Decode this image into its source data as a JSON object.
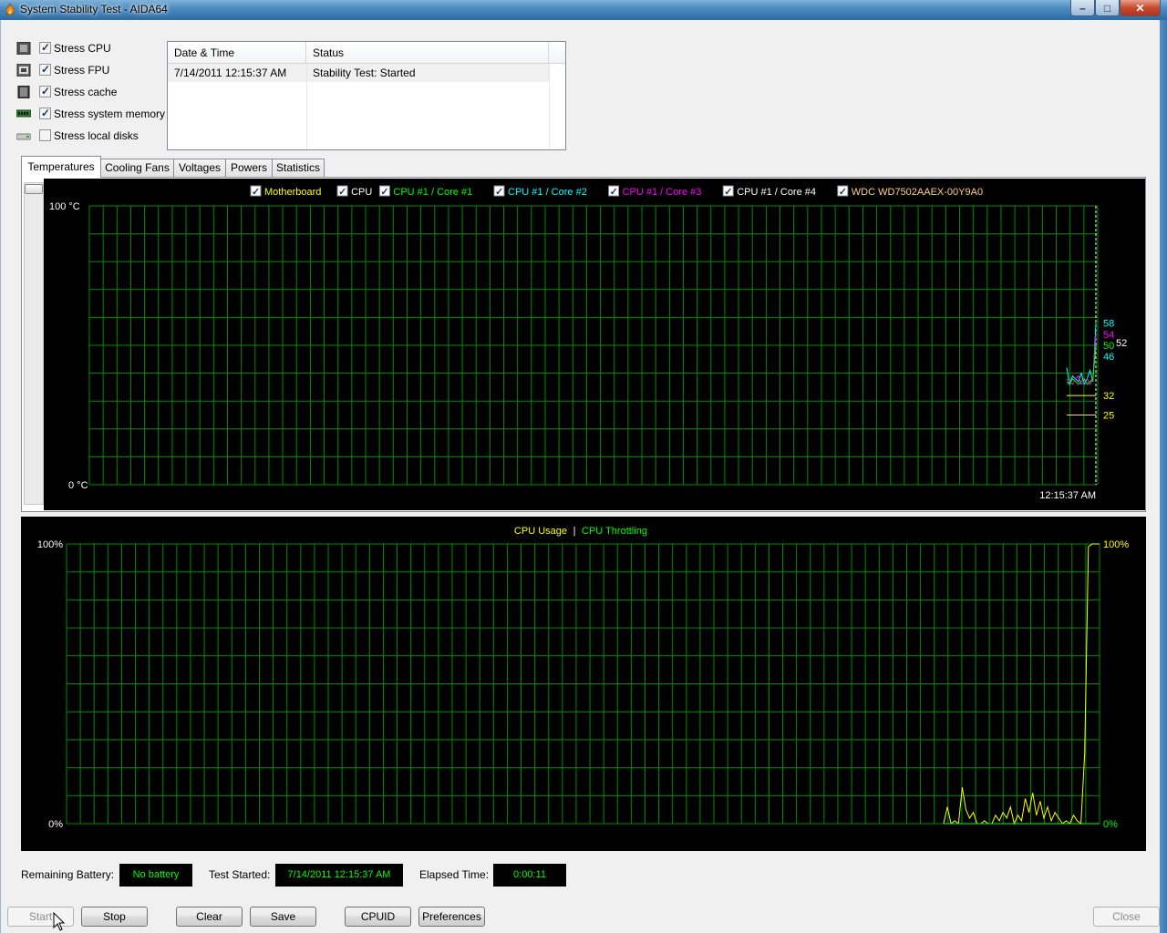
{
  "window": {
    "title": "System Stability Test - AIDA64",
    "min_glyph": "–",
    "max_glyph": "□",
    "close_glyph": "✕"
  },
  "stress_options": [
    {
      "label": "Stress CPU",
      "checked": true,
      "icon": "cpu-icon"
    },
    {
      "label": "Stress FPU",
      "checked": true,
      "icon": "fpu-icon"
    },
    {
      "label": "Stress cache",
      "checked": true,
      "icon": "cache-icon"
    },
    {
      "label": "Stress system memory",
      "checked": true,
      "icon": "memory-icon"
    },
    {
      "label": "Stress local disks",
      "checked": false,
      "icon": "disk-icon"
    }
  ],
  "log": {
    "headers": [
      "Date & Time",
      "Status"
    ],
    "rows": [
      {
        "datetime": "7/14/2011 12:15:37 AM",
        "status": "Stability Test: Started"
      }
    ]
  },
  "tabs": [
    "Temperatures",
    "Cooling Fans",
    "Voltages",
    "Powers",
    "Statistics"
  ],
  "active_tab": "Temperatures",
  "temperature_chart": {
    "y_max_label": "100 °C",
    "y_min_label": "0 °C",
    "time_label": "12:15:37 AM",
    "legend": [
      {
        "name": "Motherboard",
        "color": "#ffff00",
        "checked": true
      },
      {
        "name": "CPU",
        "color": "#ffffff",
        "checked": true
      },
      {
        "name": "CPU #1 / Core #1",
        "color": "#00ff00",
        "checked": true
      },
      {
        "name": "CPU #1 / Core #2",
        "color": "#00ffff",
        "checked": true
      },
      {
        "name": "CPU #1 / Core #3",
        "color": "#ff00ff",
        "checked": true
      },
      {
        "name": "CPU #1 / Core #4",
        "color": "#ffffff",
        "checked": true
      },
      {
        "name": "WDC WD7502AAEX-00Y9A0",
        "color": "#ffd27f",
        "checked": true
      }
    ],
    "value_labels": [
      {
        "text": "58",
        "value": 58,
        "color": "#00ffff"
      },
      {
        "text": "54",
        "value": 54,
        "color": "#ff00ff"
      },
      {
        "text": "52",
        "value": 51,
        "color": "#ffffff"
      },
      {
        "text": "50",
        "value": 50,
        "color": "#00ff00"
      },
      {
        "text": "46",
        "value": 46,
        "color": "#00ffff"
      },
      {
        "text": "32",
        "value": 32,
        "color": "#ffff00"
      },
      {
        "text": "25",
        "value": 25,
        "color": "#ffff00"
      }
    ]
  },
  "cpu_chart": {
    "legend_usage": "CPU Usage",
    "legend_separator": "|",
    "legend_throttling": "CPU Throttling",
    "usage_color": "#ffff00",
    "throttling_color": "#00ff00",
    "y_max_left": "100%",
    "y_min_left": "0%",
    "y_max_right": "100%",
    "y_min_right": "0%"
  },
  "chart_data": [
    {
      "type": "line",
      "title": "",
      "ylabel": "°C",
      "ylim": [
        0,
        100
      ],
      "series": [
        {
          "name": "CPU #1 / Core #2",
          "values": [
            42,
            36,
            39,
            38,
            37,
            40,
            36,
            38,
            41,
            37,
            58
          ]
        },
        {
          "name": "CPU #1 / Core #3",
          "values": [
            38,
            37,
            36,
            38,
            39,
            36,
            37,
            38,
            36,
            38,
            54
          ]
        },
        {
          "name": "CPU #1 / Core #1",
          "values": [
            37,
            36,
            38,
            37,
            36,
            37,
            38,
            36,
            37,
            38,
            50
          ]
        },
        {
          "name": "Motherboard",
          "values": [
            32,
            32,
            32,
            32,
            32,
            32,
            32,
            32,
            32,
            32,
            32
          ]
        },
        {
          "name": "WDC WD7502AAEX-00Y9A0",
          "values": [
            25,
            25,
            25,
            25,
            25,
            25,
            25,
            25,
            25,
            25,
            25
          ]
        }
      ]
    },
    {
      "type": "line",
      "title": "",
      "ylabel": "%",
      "ylim": [
        0,
        100
      ],
      "series": [
        {
          "name": "CPU Usage",
          "values": [
            0,
            6,
            0,
            1,
            0,
            13,
            5,
            2,
            4,
            0,
            0,
            1,
            0,
            0,
            3,
            1,
            4,
            2,
            6,
            0,
            3,
            1,
            9,
            4,
            11,
            3,
            8,
            2,
            6,
            1,
            4,
            2,
            0,
            1,
            0,
            3,
            1,
            0,
            25,
            99,
            100,
            100,
            100
          ]
        },
        {
          "name": "CPU Throttling",
          "values": [
            0,
            0,
            0,
            0,
            0,
            0,
            0,
            0,
            0,
            0,
            0,
            0,
            0,
            0,
            0,
            0,
            0,
            0,
            0,
            0,
            0,
            0,
            0,
            0,
            0,
            0,
            0,
            0,
            0,
            0,
            0,
            0,
            0,
            0,
            0,
            0,
            0,
            0,
            0,
            0,
            0,
            0,
            0
          ]
        }
      ]
    }
  ],
  "status": {
    "battery_label": "Remaining Battery:",
    "battery_value": "No battery",
    "started_label": "Test Started:",
    "started_value": "7/14/2011 12:15:37 AM",
    "elapsed_label": "Elapsed Time:",
    "elapsed_value": "0:00:11"
  },
  "buttons": {
    "start": "Start",
    "stop": "Stop",
    "clear": "Clear",
    "save": "Save",
    "cpuid": "CPUID",
    "preferences": "Preferences",
    "close": "Close"
  }
}
